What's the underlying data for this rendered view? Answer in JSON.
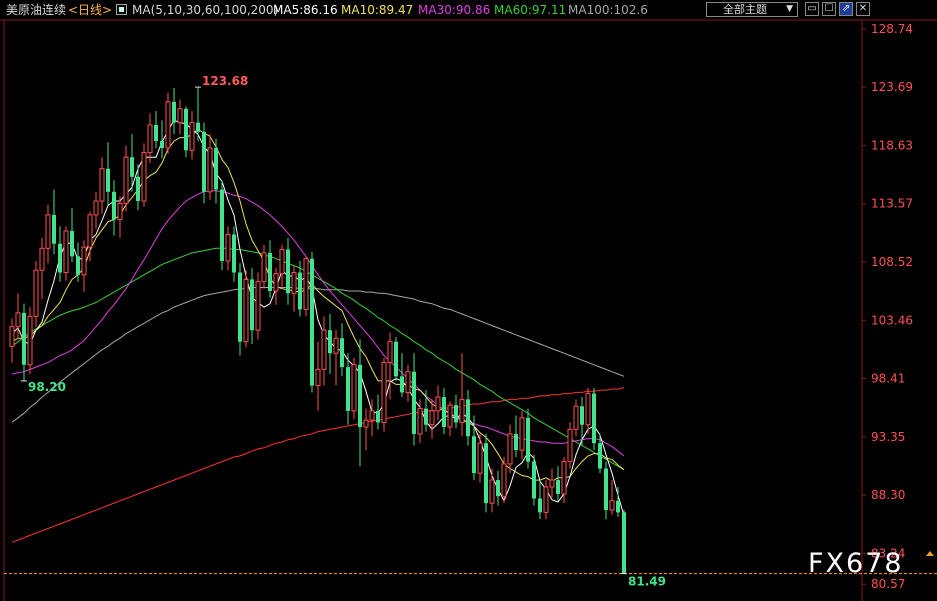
{
  "header": {
    "title": "美原油连续",
    "period": "<日线>",
    "ma_params": "MA(5,10,30,60,100,200)",
    "ma5": "MA5:86.16",
    "ma10": "MA10:89.47",
    "ma30": "MA30:90.86",
    "ma60": "MA60:97.11",
    "ma100": "MA100:102.6",
    "theme_label": "全部主题",
    "icons": [
      "window-icon",
      "checkbox-icon",
      "expand-icon",
      "close-icon"
    ]
  },
  "watermark": "FX678",
  "chart_data": {
    "type": "candlestick",
    "title": "美原油连续 日线",
    "ylim": [
      80.5,
      129.5
    ],
    "y_ticks": [
      128.74,
      123.69,
      118.63,
      113.57,
      108.52,
      103.46,
      98.41,
      93.35,
      88.3,
      83.24,
      80.57
    ],
    "annotations": [
      {
        "label": "123.68",
        "index": 31,
        "kind": "high"
      },
      {
        "label": "98.20",
        "index": 2,
        "kind": "low"
      },
      {
        "label": "81.49",
        "index": 102,
        "kind": "last"
      }
    ],
    "last_price_line": 81.49,
    "colors": {
      "up": "#ff4e4e",
      "down": "#40e48c",
      "ma5": "#ffffff",
      "ma10": "#f0e05a",
      "ma30": "#e040e0",
      "ma60": "#38d038",
      "ma100": "#a8a8a8",
      "ma200": "#ff3030",
      "last_line": "#ff9a2a",
      "axis_text": "#ff5050"
    },
    "candles": [
      [
        101.2,
        103.6,
        99.8,
        102.9
      ],
      [
        102.9,
        105.8,
        101.8,
        104.1
      ],
      [
        104.1,
        104.9,
        98.2,
        99.6
      ],
      [
        99.6,
        104.6,
        98.8,
        103.8
      ],
      [
        103.8,
        108.6,
        102.9,
        107.8
      ],
      [
        107.8,
        110.6,
        105.3,
        109.7
      ],
      [
        109.7,
        113.5,
        108.4,
        112.6
      ],
      [
        112.6,
        114.8,
        109.2,
        110.1
      ],
      [
        110.1,
        111.6,
        106.8,
        107.6
      ],
      [
        107.6,
        111.6,
        106.9,
        111.2
      ],
      [
        111.2,
        113.2,
        108.5,
        109.0
      ],
      [
        109.0,
        110.2,
        106.8,
        107.4
      ],
      [
        107.4,
        110.4,
        105.9,
        109.8
      ],
      [
        109.8,
        112.9,
        108.6,
        112.6
      ],
      [
        112.6,
        114.6,
        111.4,
        113.8
      ],
      [
        113.8,
        117.6,
        112.7,
        116.6
      ],
      [
        116.6,
        118.9,
        113.4,
        114.6
      ],
      [
        114.6,
        115.6,
        110.8,
        112.2
      ],
      [
        112.2,
        114.2,
        110.6,
        113.6
      ],
      [
        113.6,
        118.6,
        112.9,
        117.6
      ],
      [
        117.6,
        119.6,
        114.6,
        115.9
      ],
      [
        115.9,
        117.0,
        113.0,
        113.8
      ],
      [
        113.8,
        118.8,
        113.3,
        118.0
      ],
      [
        118.0,
        121.4,
        117.1,
        120.4
      ],
      [
        120.4,
        121.6,
        118.4,
        119.0
      ],
      [
        119.0,
        120.8,
        117.5,
        118.4
      ],
      [
        118.4,
        123.2,
        117.9,
        122.4
      ],
      [
        122.4,
        123.6,
        119.6,
        120.6
      ],
      [
        120.6,
        122.6,
        119.6,
        121.8
      ],
      [
        121.8,
        122.0,
        117.6,
        118.2
      ],
      [
        118.2,
        121.6,
        117.4,
        120.6
      ],
      [
        120.6,
        123.68,
        119.0,
        119.8
      ],
      [
        119.8,
        120.6,
        113.6,
        114.6
      ],
      [
        114.6,
        119.6,
        113.9,
        118.4
      ],
      [
        118.4,
        119.2,
        113.6,
        114.8
      ],
      [
        114.8,
        115.6,
        107.8,
        108.6
      ],
      [
        108.6,
        111.6,
        107.8,
        110.9
      ],
      [
        110.9,
        111.6,
        106.8,
        107.6
      ],
      [
        107.6,
        108.4,
        100.4,
        101.6
      ],
      [
        101.6,
        107.8,
        101.1,
        107.0
      ],
      [
        107.0,
        108.0,
        101.4,
        102.6
      ],
      [
        102.6,
        107.6,
        101.8,
        106.8
      ],
      [
        106.8,
        110.0,
        106.2,
        109.3
      ],
      [
        109.3,
        110.4,
        105.4,
        106.0
      ],
      [
        106.0,
        108.0,
        104.8,
        107.5
      ],
      [
        107.5,
        110.0,
        106.4,
        109.6
      ],
      [
        109.6,
        110.6,
        104.8,
        105.8
      ],
      [
        105.8,
        108.2,
        104.2,
        107.6
      ],
      [
        107.6,
        108.6,
        103.8,
        104.4
      ],
      [
        104.4,
        109.0,
        103.8,
        108.8
      ],
      [
        108.8,
        109.4,
        97.2,
        97.8
      ],
      [
        97.8,
        101.6,
        95.6,
        99.2
      ],
      [
        99.2,
        103.8,
        97.8,
        102.6
      ],
      [
        102.6,
        104.0,
        98.8,
        100.6
      ],
      [
        100.6,
        102.6,
        97.8,
        101.9
      ],
      [
        101.9,
        103.2,
        98.6,
        99.4
      ],
      [
        99.4,
        100.6,
        94.4,
        95.6
      ],
      [
        95.6,
        100.2,
        94.9,
        99.6
      ],
      [
        99.6,
        101.8,
        90.8,
        94.2
      ],
      [
        94.2,
        95.8,
        92.2,
        94.8
      ],
      [
        94.8,
        96.6,
        93.4,
        95.6
      ],
      [
        95.6,
        97.0,
        94.0,
        94.6
      ],
      [
        94.6,
        100.2,
        93.8,
        99.8
      ],
      [
        99.8,
        102.4,
        96.6,
        101.6
      ],
      [
        101.6,
        102.0,
        98.2,
        98.6
      ],
      [
        98.6,
        100.6,
        96.8,
        97.2
      ],
      [
        97.2,
        99.6,
        96.4,
        99.0
      ],
      [
        99.0,
        100.6,
        92.6,
        93.6
      ],
      [
        93.6,
        96.6,
        92.8,
        95.8
      ],
      [
        95.8,
        97.4,
        93.8,
        94.4
      ],
      [
        94.4,
        96.6,
        93.2,
        95.6
      ],
      [
        95.6,
        97.8,
        94.8,
        96.8
      ],
      [
        96.8,
        97.6,
        93.6,
        94.2
      ],
      [
        94.2,
        96.4,
        93.4,
        96.1
      ],
      [
        96.1,
        97.0,
        94.1,
        94.6
      ],
      [
        94.6,
        100.6,
        93.4,
        96.6
      ],
      [
        96.6,
        97.4,
        92.6,
        93.4
      ],
      [
        93.4,
        95.2,
        89.6,
        90.2
      ],
      [
        90.2,
        93.6,
        89.4,
        92.8
      ],
      [
        92.8,
        93.6,
        86.8,
        87.6
      ],
      [
        87.6,
        90.6,
        86.8,
        89.6
      ],
      [
        89.6,
        90.4,
        87.4,
        88.2
      ],
      [
        88.2,
        91.6,
        87.6,
        91.0
      ],
      [
        91.0,
        94.4,
        90.2,
        93.6
      ],
      [
        93.6,
        95.2,
        91.6,
        92.2
      ],
      [
        92.2,
        95.6,
        91.4,
        95.0
      ],
      [
        95.0,
        95.8,
        90.6,
        91.2
      ],
      [
        91.2,
        91.8,
        87.4,
        88.0
      ],
      [
        88.0,
        89.6,
        86.2,
        86.8
      ],
      [
        86.8,
        89.6,
        86.2,
        89.0
      ],
      [
        89.0,
        90.6,
        88.1,
        89.6
      ],
      [
        89.6,
        90.8,
        87.8,
        88.4
      ],
      [
        88.4,
        91.6,
        87.6,
        91.2
      ],
      [
        91.2,
        94.6,
        90.6,
        94.0
      ],
      [
        94.0,
        96.6,
        93.4,
        96.0
      ],
      [
        96.0,
        96.8,
        92.6,
        94.4
      ],
      [
        94.4,
        97.6,
        93.6,
        97.1
      ],
      [
        97.1,
        97.6,
        92.2,
        92.8
      ],
      [
        92.8,
        93.6,
        90.2,
        90.6
      ],
      [
        90.6,
        91.2,
        86.2,
        87.0
      ],
      [
        87.0,
        89.6,
        86.6,
        87.8
      ],
      [
        87.8,
        89.0,
        86.4,
        86.8
      ],
      [
        86.8,
        87.0,
        81.49,
        81.49
      ]
    ],
    "ma5": [
      102.3,
      102.8,
      101.6,
      101.4,
      102.6,
      103.3,
      105.2,
      106.9,
      109.0,
      110.2,
      110.1,
      108.7,
      108.9,
      110.4,
      110.9,
      112.1,
      113.4,
      113.8,
      113.8,
      114.4,
      115.0,
      116.6,
      117.6,
      117.6,
      117.6,
      118.9,
      119.9,
      120.8,
      120.6,
      120.5,
      120.0,
      119.6,
      118.5,
      117.9,
      116.2,
      115.5,
      113.9,
      112.6,
      109.6,
      107.3,
      105.4,
      105.0,
      104.6,
      104.9,
      106.2,
      107.8,
      107.3,
      107.3,
      106.9,
      107.2,
      106.3,
      103.5,
      102.2,
      101.6,
      101.0,
      100.8,
      100.0,
      99.5,
      98.9,
      97.3,
      95.5,
      95.4,
      96.2,
      98.1,
      98.4,
      98.2,
      97.6,
      96.6,
      95.9,
      94.7,
      94.0,
      94.5,
      95.1,
      95.2,
      94.9,
      95.4,
      95.0,
      94.3,
      93.1,
      91.6,
      90.0,
      88.8,
      87.8,
      89.1,
      90.7,
      91.1,
      92.0,
      91.5,
      89.5,
      88.8,
      87.9,
      87.7,
      88.4,
      89.9,
      91.8,
      93.1,
      94.0,
      94.3,
      93.5,
      91.8,
      90.2,
      88.3,
      86.5
    ],
    "ma10": [
      101.6,
      101.9,
      101.9,
      102.1,
      102.6,
      103.0,
      103.8,
      104.4,
      105.0,
      106.1,
      107.0,
      107.4,
      108.0,
      109.5,
      110.6,
      111.3,
      112.0,
      112.2,
      112.6,
      113.5,
      114.1,
      114.8,
      115.6,
      116.0,
      116.3,
      117.1,
      118.3,
      119.0,
      119.3,
      119.3,
      119.6,
      120.0,
      119.7,
      119.4,
      118.5,
      117.4,
      116.7,
      115.4,
      113.8,
      111.8,
      110.4,
      109.5,
      108.6,
      107.1,
      106.4,
      106.2,
      106.1,
      106.0,
      105.9,
      106.1,
      106.6,
      106.0,
      105.5,
      105.1,
      104.7,
      104.3,
      103.1,
      102.0,
      101.0,
      100.3,
      99.2,
      98.2,
      98.2,
      98.2,
      97.9,
      97.9,
      97.9,
      97.5,
      97.4,
      96.8,
      96.2,
      95.9,
      95.6,
      95.4,
      95.0,
      94.8,
      94.6,
      94.3,
      93.7,
      93.3,
      92.7,
      91.9,
      91.0,
      90.6,
      90.3,
      90.0,
      89.9,
      89.6,
      89.6,
      89.8,
      89.5,
      89.8,
      89.8,
      89.9,
      90.6,
      91.2,
      91.7,
      91.9,
      91.9,
      91.5,
      91.4,
      90.9,
      90.5
    ],
    "ma30": [
      98.8,
      98.9,
      99.0,
      99.2,
      99.4,
      99.6,
      99.8,
      100.1,
      100.4,
      100.6,
      100.9,
      101.3,
      101.7,
      102.3,
      102.9,
      103.5,
      104.2,
      104.8,
      105.5,
      106.2,
      107.0,
      107.9,
      108.7,
      109.6,
      110.5,
      111.4,
      112.1,
      112.7,
      113.3,
      113.8,
      114.1,
      114.4,
      114.6,
      114.7,
      114.7,
      114.6,
      114.5,
      114.3,
      114.2,
      114.0,
      113.7,
      113.4,
      113.0,
      112.6,
      112.1,
      111.6,
      111.0,
      110.4,
      109.7,
      109.0,
      108.2,
      107.4,
      106.7,
      106.0,
      105.4,
      104.8,
      104.2,
      103.6,
      103.0,
      102.4,
      101.8,
      101.1,
      100.4,
      99.9,
      99.4,
      98.9,
      98.4,
      97.9,
      97.4,
      96.9,
      96.5,
      96.1,
      95.7,
      95.4,
      95.1,
      94.9,
      94.7,
      94.5,
      94.3,
      94.2,
      94.0,
      93.8,
      93.6,
      93.4,
      93.3,
      93.2,
      93.1,
      93.0,
      92.9,
      92.9,
      92.8,
      92.8,
      92.8,
      92.9,
      93.0,
      93.1,
      93.2,
      93.2,
      93.1,
      92.8,
      92.5,
      92.1,
      91.7
    ],
    "ma60": [
      101.2,
      101.6,
      102.0,
      102.4,
      102.7,
      103.0,
      103.3,
      103.6,
      103.9,
      104.1,
      104.3,
      104.4,
      104.6,
      104.8,
      105.0,
      105.3,
      105.6,
      105.9,
      106.2,
      106.5,
      106.8,
      107.1,
      107.4,
      107.7,
      108.0,
      108.3,
      108.5,
      108.7,
      108.9,
      109.1,
      109.3,
      109.4,
      109.5,
      109.6,
      109.7,
      109.7,
      109.7,
      109.6,
      109.6,
      109.5,
      109.4,
      109.3,
      109.1,
      109.0,
      108.8,
      108.6,
      108.4,
      108.2,
      108.0,
      107.7,
      107.4,
      107.1,
      106.8,
      106.5,
      106.2,
      105.8,
      105.5,
      105.2,
      104.8,
      104.5,
      104.1,
      103.7,
      103.4,
      103.0,
      102.7,
      102.3,
      102.0,
      101.6,
      101.3,
      100.9,
      100.6,
      100.2,
      99.9,
      99.6,
      99.2,
      98.9,
      98.6,
      98.3,
      97.9,
      97.6,
      97.3,
      96.9,
      96.6,
      96.3,
      96.0,
      95.7,
      95.4,
      95.0,
      94.7,
      94.4,
      94.1,
      93.8,
      93.5,
      93.2,
      92.9,
      92.6,
      92.3,
      92.0,
      91.7,
      91.4,
      91.1,
      90.8,
      90.5
    ],
    "ma100": [
      94.6,
      95.0,
      95.4,
      95.9,
      96.3,
      96.8,
      97.2,
      97.6,
      98.1,
      98.5,
      98.9,
      99.3,
      99.7,
      100.1,
      100.5,
      100.9,
      101.2,
      101.6,
      101.9,
      102.3,
      102.6,
      102.9,
      103.2,
      103.5,
      103.8,
      104.1,
      104.3,
      104.6,
      104.8,
      105.0,
      105.2,
      105.4,
      105.6,
      105.7,
      105.8,
      105.9,
      106.0,
      106.1,
      106.2,
      106.2,
      106.3,
      106.3,
      106.3,
      106.3,
      106.3,
      106.3,
      106.3,
      106.3,
      106.2,
      106.2,
      106.2,
      106.2,
      106.1,
      106.1,
      106.1,
      106.1,
      106.0,
      106.0,
      106.0,
      105.9,
      105.9,
      105.8,
      105.8,
      105.7,
      105.6,
      105.5,
      105.4,
      105.3,
      105.1,
      105.0,
      104.9,
      104.7,
      104.5,
      104.4,
      104.2,
      104.0,
      103.8,
      103.6,
      103.4,
      103.2,
      103.0,
      102.8,
      102.6,
      102.4,
      102.2,
      102.0,
      101.8,
      101.6,
      101.4,
      101.2,
      101.0,
      100.8,
      100.6,
      100.4,
      100.2,
      100.0,
      99.8,
      99.6,
      99.4,
      99.2,
      99.0,
      98.8,
      98.6
    ],
    "ma200": [
      84.2,
      84.4,
      84.6,
      84.8,
      85.0,
      85.2,
      85.4,
      85.6,
      85.8,
      86.0,
      86.2,
      86.4,
      86.6,
      86.8,
      87.0,
      87.2,
      87.4,
      87.6,
      87.8,
      88.0,
      88.2,
      88.4,
      88.6,
      88.8,
      89.0,
      89.2,
      89.4,
      89.6,
      89.8,
      90.0,
      90.2,
      90.4,
      90.6,
      90.8,
      91.0,
      91.2,
      91.4,
      91.6,
      91.7,
      91.9,
      92.1,
      92.3,
      92.4,
      92.6,
      92.8,
      92.9,
      93.1,
      93.2,
      93.4,
      93.5,
      93.6,
      93.8,
      93.9,
      94.0,
      94.1,
      94.2,
      94.3,
      94.4,
      94.5,
      94.6,
      94.7,
      94.8,
      94.9,
      95.0,
      95.1,
      95.2,
      95.3,
      95.4,
      95.5,
      95.6,
      95.6,
      95.7,
      95.8,
      95.9,
      95.9,
      96.0,
      96.1,
      96.2,
      96.2,
      96.3,
      96.4,
      96.4,
      96.5,
      96.6,
      96.6,
      96.7,
      96.7,
      96.8,
      96.9,
      96.9,
      97.0,
      97.0,
      97.1,
      97.1,
      97.2,
      97.2,
      97.3,
      97.3,
      97.4,
      97.4,
      97.5,
      97.5,
      97.6
    ]
  }
}
